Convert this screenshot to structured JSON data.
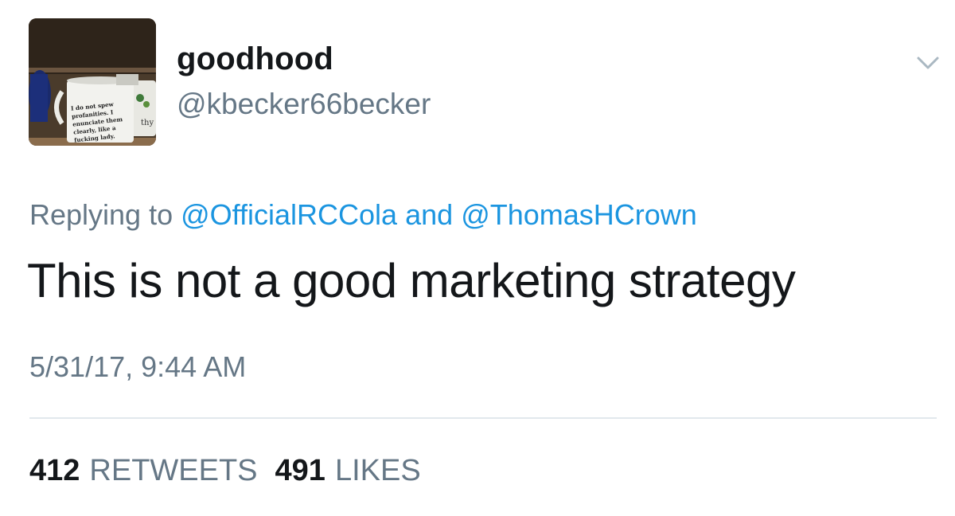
{
  "user": {
    "display_name": "goodhood",
    "handle": "@kbecker66becker",
    "avatar_mug_text": [
      "I do not spew",
      "profanities. I",
      "enunciate them",
      "clearly, like a",
      "fucking lady."
    ],
    "avatar_side_text": "thy"
  },
  "reply": {
    "prefix": "Replying to",
    "mention_1": "@OfficialRCCola",
    "joiner": "and",
    "mention_2": "@ThomasHCrown"
  },
  "tweet": {
    "text": "This is not a good marketing strategy",
    "timestamp": "5/31/17, 9:44 AM"
  },
  "stats": {
    "retweets_count": "412",
    "retweets_label": "RETWEETS",
    "likes_count": "491",
    "likes_label": "LIKES"
  },
  "icons": {
    "menu": "chevron-down-icon"
  },
  "colors": {
    "text_primary": "#14171a",
    "text_secondary": "#657786",
    "link": "#1b95e0",
    "divider": "#e1e8ed"
  }
}
